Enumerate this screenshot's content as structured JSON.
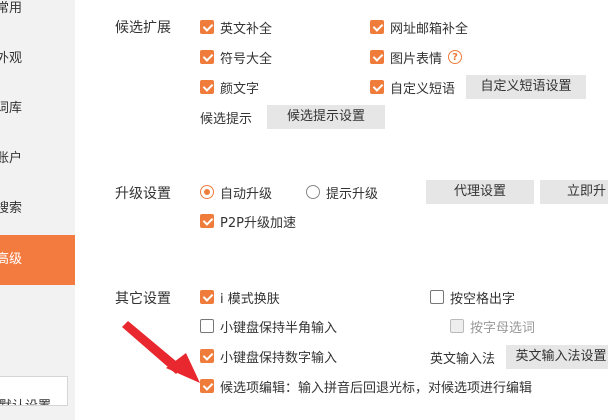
{
  "sidebar": {
    "items": [
      {
        "label": "常用"
      },
      {
        "label": "外观"
      },
      {
        "label": "词库"
      },
      {
        "label": "账户"
      },
      {
        "label": "搜索"
      },
      {
        "label": "高级"
      }
    ],
    "reset_label": "默认设置"
  },
  "candidates": {
    "title": "候选扩展",
    "english": "英文补全",
    "url_email": "网址邮箱补全",
    "symbols": "符号大全",
    "image_emoji": "图片表情",
    "kaomoji": "颜文字",
    "custom_phrase": "自定义短语",
    "custom_phrase_btn": "自定义短语设置",
    "hint_label": "候选提示",
    "hint_btn": "候选提示设置"
  },
  "upgrade": {
    "title": "升级设置",
    "auto": "自动升级",
    "prompt": "提示升级",
    "proxy_btn": "代理设置",
    "now_btn": "立即升",
    "p2p": "P2P升级加速"
  },
  "other": {
    "title": "其它设置",
    "i_mode": "i 模式换肤",
    "space_output": "按空格出字",
    "half_width": "小键盘保持半角输入",
    "letter_select": "按字母选词",
    "keep_digits": "小键盘保持数字输入",
    "eng_method_label": "英文输入法",
    "eng_method_btn": "英文输入法设置",
    "edit_candidates": "候选项编辑：输入拼音后回退光标，对候选项进行编辑"
  },
  "colors": {
    "accent": "#f07c3c",
    "sidebar_active": "#f47b40",
    "arrow": "#e8282e"
  }
}
